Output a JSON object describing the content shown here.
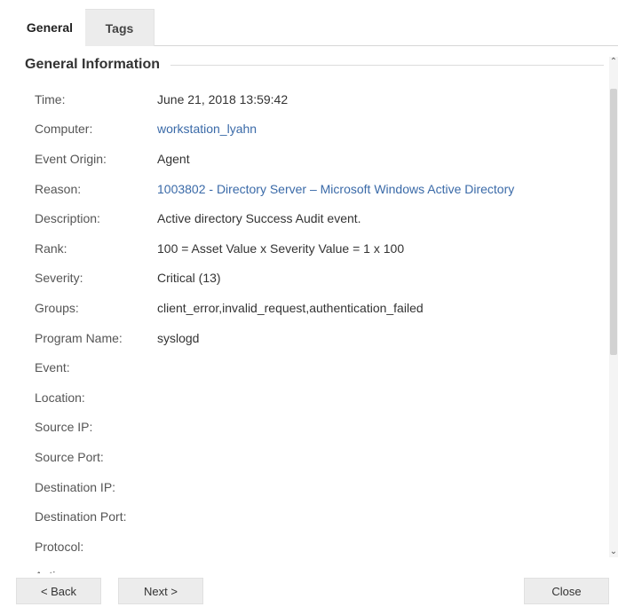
{
  "tabs": [
    {
      "label": "General",
      "active": true
    },
    {
      "label": "Tags",
      "active": false
    }
  ],
  "section": {
    "title": "General Information"
  },
  "fields": [
    {
      "label": "Time:",
      "value": "June 21, 2018 13:59:42",
      "link": false
    },
    {
      "label": "Computer:",
      "value": "workstation_lyahn",
      "link": true
    },
    {
      "label": "Event Origin:",
      "value": "Agent",
      "link": false
    },
    {
      "label": "Reason:",
      "value": "1003802 - Directory Server – Microsoft Windows Active Directory",
      "link": true
    },
    {
      "label": "Description:",
      "value": "Active directory Success Audit event.",
      "link": false
    },
    {
      "label": "Rank:",
      "value": "100 = Asset Value x Severity Value = 1 x 100",
      "link": false
    },
    {
      "label": "Severity:",
      "value": "Critical (13)",
      "link": false
    },
    {
      "label": "Groups:",
      "value": "client_error,invalid_request,authentication_failed",
      "link": false
    },
    {
      "label": "Program Name:",
      "value": "syslogd",
      "link": false
    },
    {
      "label": "Event:",
      "value": "",
      "link": false
    },
    {
      "label": "Location:",
      "value": "",
      "link": false
    },
    {
      "label": "Source IP:",
      "value": "",
      "link": false
    },
    {
      "label": "Source Port:",
      "value": "",
      "link": false
    },
    {
      "label": "Destination IP:",
      "value": "",
      "link": false
    },
    {
      "label": "Destination Port:",
      "value": "",
      "link": false
    },
    {
      "label": "Protocol:",
      "value": "",
      "link": false
    },
    {
      "label": "Action:",
      "value": "",
      "link": false
    }
  ],
  "buttons": {
    "back": "< Back",
    "next": "Next >",
    "close": "Close"
  },
  "colors": {
    "link": "#3a6aa8",
    "button_bg": "#ececec",
    "scroll_thumb": "#d2d2d2"
  },
  "scrollbar": {
    "up_icon": "chevron-up-icon",
    "down_icon": "chevron-down-icon"
  }
}
